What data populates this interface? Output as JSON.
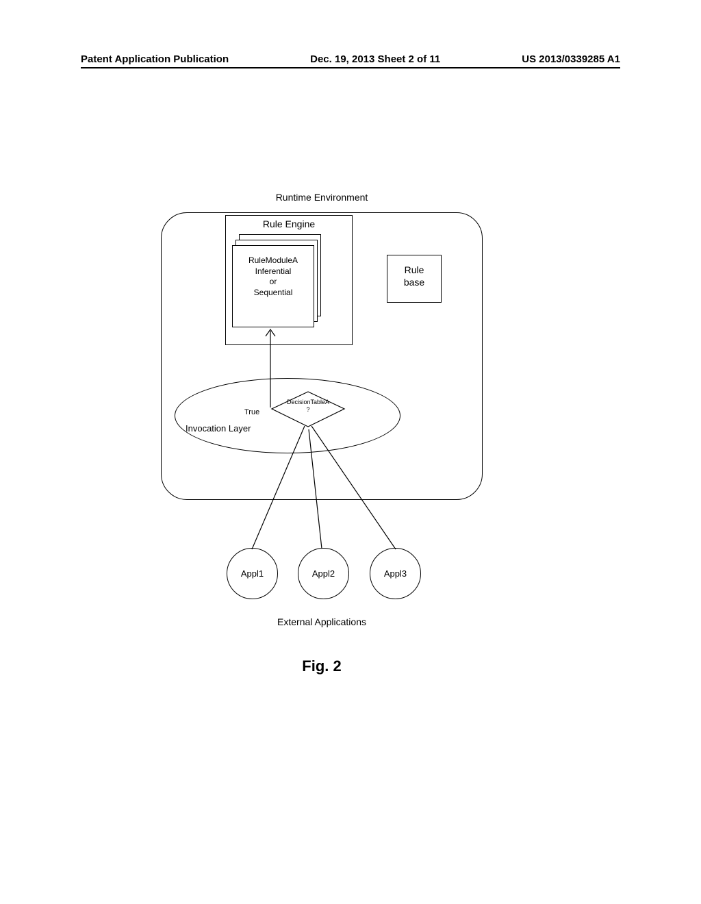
{
  "header": {
    "left": "Patent Application Publication",
    "center": "Dec. 19, 2013  Sheet 2 of 11",
    "right": "US 2013/0339285 A1"
  },
  "diagram": {
    "runtime_title": "Runtime Environment",
    "rule_engine_title": "Rule Engine",
    "module": {
      "line1": "RuleModuleA",
      "line2": "Inferential",
      "line3": "or",
      "line4": "Sequential"
    },
    "rulebase": {
      "line1": "Rule",
      "line2": "base"
    },
    "decision": {
      "label": "DecisionTableA",
      "mark": "?"
    },
    "true_label": "True",
    "invocation_label": "Invocation Layer",
    "apps": {
      "a1": "Appl1",
      "a2": "Appl2",
      "a3": "Appl3"
    },
    "ext_apps_title": "External Applications",
    "figure_label": "Fig. 2"
  }
}
